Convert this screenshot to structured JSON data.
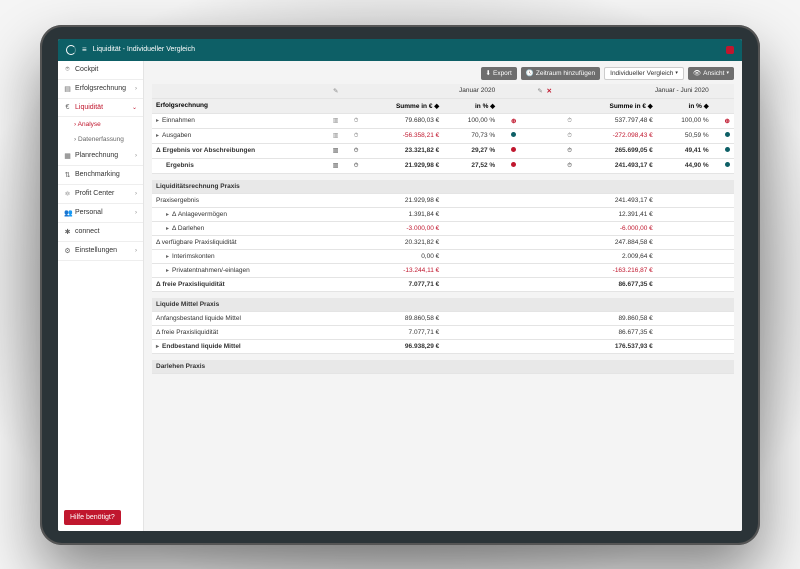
{
  "header": {
    "title": "Liquidität - Individueller Vergleich"
  },
  "toolbar": {
    "export": "Export",
    "add_period": "Zeitraum hinzufügen",
    "comparison": "Individueller Vergleich",
    "view": "Ansicht"
  },
  "sidebar": {
    "items": [
      {
        "label": "Cockpit"
      },
      {
        "label": "Erfolgsrechnung"
      },
      {
        "label": "Liquidität",
        "active": true
      },
      {
        "label": "Planrechnung"
      },
      {
        "label": "Benchmarking"
      },
      {
        "label": "Profit Center"
      },
      {
        "label": "Personal"
      },
      {
        "label": "connect"
      },
      {
        "label": "Einstellungen"
      }
    ],
    "subs": [
      {
        "label": "Analyse",
        "active": true
      },
      {
        "label": "Datenerfassung"
      }
    ],
    "help": "Hilfe benötigt?"
  },
  "periods": {
    "p1": "Januar 2020",
    "p2": "Januar - Juni 2020"
  },
  "columns": {
    "main": "Erfolgsrechnung",
    "sum": "Summe in €",
    "pct": "in %"
  },
  "sections": {
    "liq_praxis": "Liquiditätsrechnung Praxis",
    "liq_mittel": "Liquide Mittel Praxis",
    "darlehen": "Darlehen Praxis"
  },
  "rows": {
    "einnahmen": {
      "label": "Einnahmen",
      "v1": "79.680,03 €",
      "p1": "100,00 %",
      "v2": "537.797,48 €",
      "p2": "100,00 %"
    },
    "ausgaben": {
      "label": "Ausgaben",
      "v1": "-56.358,21 €",
      "p1": "70,73 %",
      "v2": "-272.098,43 €",
      "p2": "50,59 %"
    },
    "erg_vor_abs": {
      "label": "Ergebnis vor Abschreibungen",
      "v1": "23.321,82 €",
      "p1": "29,27 %",
      "v2": "265.699,05 €",
      "p2": "49,41 %"
    },
    "ergebnis": {
      "label": "Ergebnis",
      "v1": "21.929,98 €",
      "p1": "27,52 %",
      "v2": "241.493,17 €",
      "p2": "44,90 %"
    },
    "praxisergebnis": {
      "label": "Praxisergebnis",
      "v1": "21.929,98 €",
      "v2": "241.493,17 €"
    },
    "anlage": {
      "label": "Anlagevermögen",
      "v1": "1.391,84 €",
      "v2": "12.391,41 €"
    },
    "darlehen_d": {
      "label": "Darlehen",
      "v1": "-3.000,00 €",
      "v2": "-6.000,00 €"
    },
    "verf_liq": {
      "label": "verfügbare Praxisliquidität",
      "v1": "20.321,82 €",
      "v2": "247.884,58 €"
    },
    "interim": {
      "label": "Interimskonten",
      "v1": "0,00 €",
      "v2": "2.009,64 €"
    },
    "privat": {
      "label": "Privatentnahmen/-einlagen",
      "v1": "-13.244,11 €",
      "v2": "-163.216,87 €"
    },
    "freie_liq": {
      "label": "freie Praxisliquidität",
      "v1": "7.077,71 €",
      "v2": "86.677,35 €"
    },
    "anf_bestand": {
      "label": "Anfangsbestand liquide Mittel",
      "v1": "89.860,58 €",
      "v2": "89.860,58 €"
    },
    "freie_liq2": {
      "label": "freie Praxisliquidität",
      "v1": "7.077,71 €",
      "v2": "86.677,35 €"
    },
    "end_bestand": {
      "label": "Endbestand liquide Mittel",
      "v1": "96.938,29 €",
      "v2": "176.537,93 €"
    }
  }
}
